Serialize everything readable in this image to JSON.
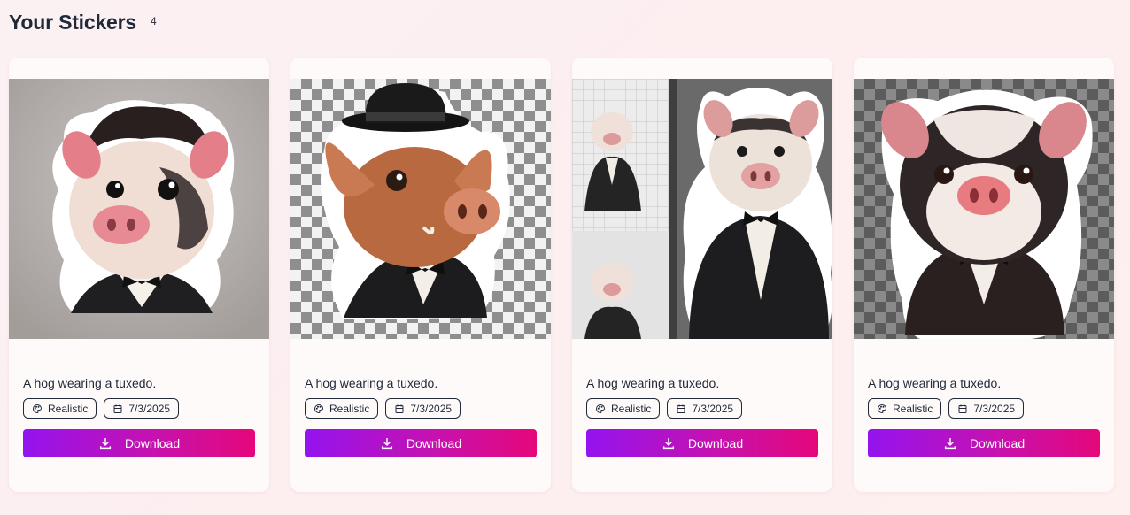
{
  "header": {
    "title": "Your Stickers",
    "count": "4"
  },
  "stickers": [
    {
      "description": "A hog wearing a tuxedo.",
      "style": "Realistic",
      "date": "7/3/2025",
      "download_label": "Download"
    },
    {
      "description": "A hog wearing a tuxedo.",
      "style": "Realistic",
      "date": "7/3/2025",
      "download_label": "Download"
    },
    {
      "description": "A hog wearing a tuxedo.",
      "style": "Realistic",
      "date": "7/3/2025",
      "download_label": "Download"
    },
    {
      "description": "A hog wearing a tuxedo.",
      "style": "Realistic",
      "date": "7/3/2025",
      "download_label": "Download"
    }
  ],
  "colors": {
    "button_start": "#9413ef",
    "button_end": "#e5077a",
    "title": "#1f2937"
  },
  "icons": {
    "style_tag": "palette-icon",
    "date_tag": "calendar-icon",
    "download": "download-icon"
  }
}
